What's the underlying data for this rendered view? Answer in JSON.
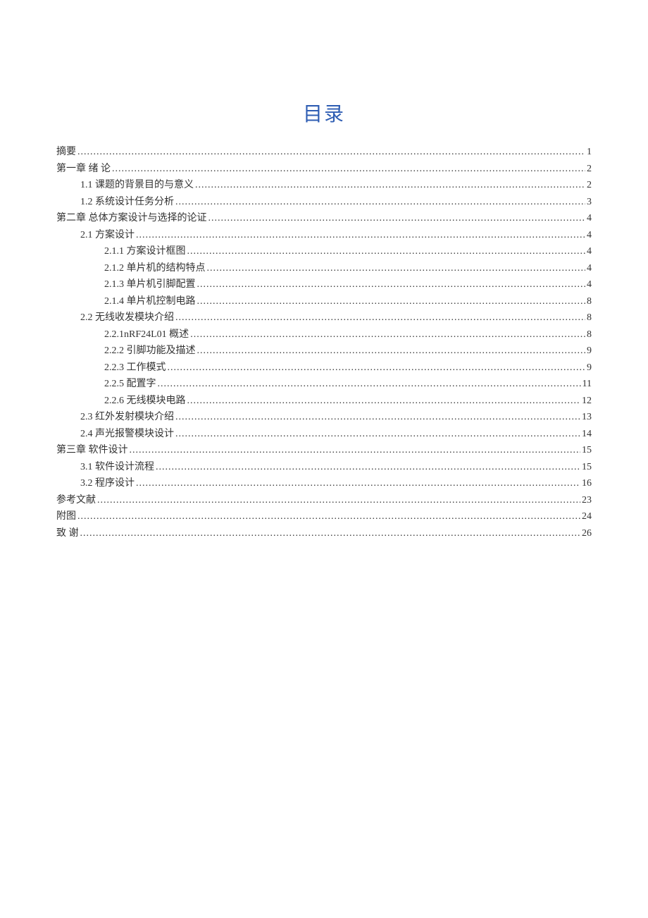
{
  "title": "目录",
  "toc": [
    {
      "label": "摘要",
      "page": "1",
      "indent": 0
    },
    {
      "label": "第一章      绪 论",
      "page": "2",
      "indent": 0
    },
    {
      "label": "1.1 课题的背景目的与意义",
      "page": "2",
      "indent": 1
    },
    {
      "label": "1.2 系统设计任务分析",
      "page": "3",
      "indent": 1
    },
    {
      "label": "第二章  总体方案设计与选择的论证",
      "page": "4",
      "indent": 0
    },
    {
      "label": "2.1  方案设计",
      "page": "4",
      "indent": 1
    },
    {
      "label": "2.1.1  方案设计框图",
      "page": "4",
      "indent": 2
    },
    {
      "label": "2.1.2 单片机的结构特点",
      "page": "4",
      "indent": 2
    },
    {
      "label": "2.1.3 单片机引脚配置",
      "page": "4",
      "indent": 2
    },
    {
      "label": "2.1.4 单片机控制电路",
      "page": "8",
      "indent": 2
    },
    {
      "label": "2.2 无线收发模块介绍",
      "page": "8",
      "indent": 1
    },
    {
      "label": "2.2.1nRF24L01 概述",
      "page": "8",
      "indent": 2
    },
    {
      "label": "2.2.2  引脚功能及描述",
      "page": "9",
      "indent": 2
    },
    {
      "label": "2.2.3 工作模式",
      "page": "9",
      "indent": 2
    },
    {
      "label": "2.2.5 配置字",
      "page": "11",
      "indent": 2
    },
    {
      "label": "2.2.6 无线模块电路",
      "page": "12",
      "indent": 2
    },
    {
      "label": "2.3 红外发射模块介绍",
      "page": "13",
      "indent": 1
    },
    {
      "label": "2.4  声光报警模块设计",
      "page": "14",
      "indent": 1
    },
    {
      "label": "第三章      软件设计",
      "page": "15",
      "indent": 0
    },
    {
      "label": "3.1  软件设计流程",
      "page": "15",
      "indent": 1
    },
    {
      "label": "3.2 程序设计",
      "page": "16",
      "indent": 1
    },
    {
      "label": "参考文献",
      "page": "23",
      "indent": 0
    },
    {
      "label": "附图",
      "page": "24",
      "indent": 0
    },
    {
      "label": "致  谢",
      "page": "26",
      "indent": 0
    }
  ]
}
